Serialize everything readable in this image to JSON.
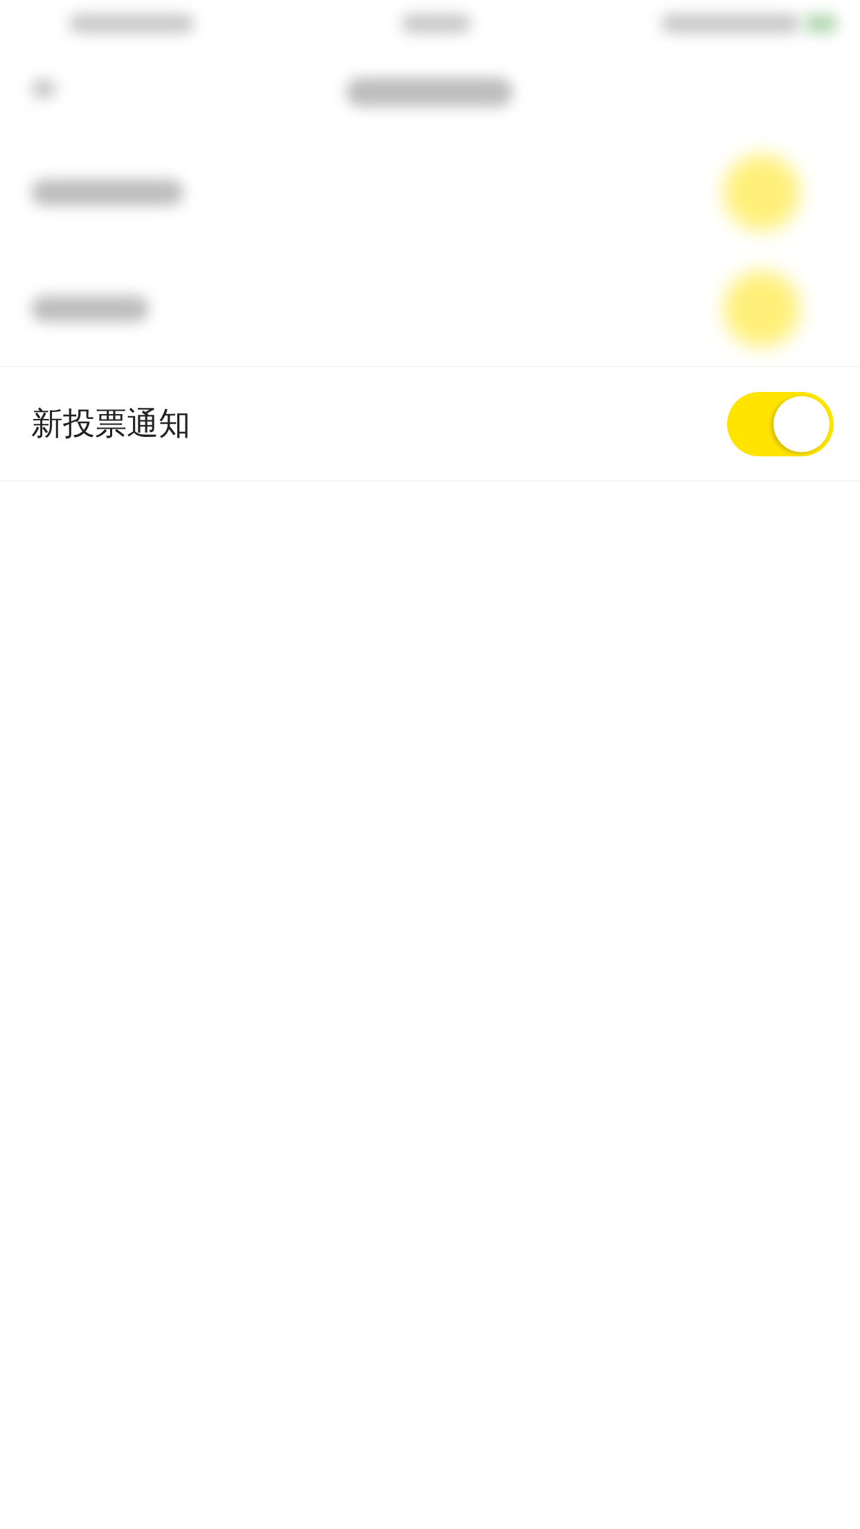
{
  "settings": [
    {
      "label": "新投票通知",
      "on": true
    }
  ]
}
